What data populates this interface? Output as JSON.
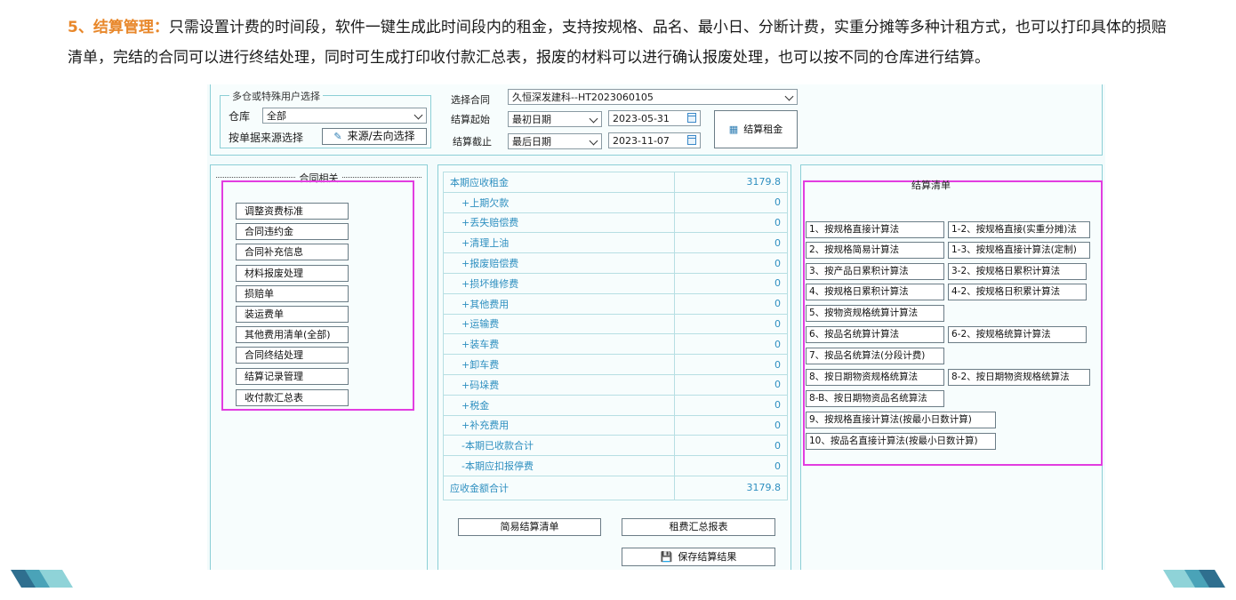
{
  "intro": {
    "highlight": "5、结算管理：",
    "text": "只需设置计费的时间段，软件一键生成此时间段内的租金，支持按规格、品名、最小日、分断计费，实重分摊等多种计租方式，也可以打印具体的损赔清单，完结的合同可以进行终结处理，同时可生成打印收付款汇总表，报废的材料可以进行确认报废处理，也可以按不同的仓库进行结算。"
  },
  "top": {
    "group_legend": "多仓或特殊用户选择",
    "warehouse_label": "仓库",
    "warehouse_value": "全部",
    "source_label": "按单据来源选择",
    "source_button": "来源/去向选择",
    "contract_label": "选择合同",
    "contract_value": "久恒深发建科--HT2023060105",
    "start_label": "结算起始",
    "start_mode": "最初日期",
    "start_date": "2023-05-31",
    "end_label": "结算截止",
    "end_mode": "最后日期",
    "end_date": "2023-11-07",
    "calc_button": "结算租金"
  },
  "left_panel": {
    "title": "合同相关",
    "buttons": [
      "调整资费标准",
      "合同违约金",
      "合同补充信息",
      "材料报废处理",
      "损赔单",
      "装运费单",
      "其他费用清单(全部)",
      "合同终结处理",
      "结算记录管理",
      "收付款汇总表"
    ]
  },
  "rent_table": {
    "header": {
      "name": "本期应收租金",
      "value": "3179.8"
    },
    "rows": [
      {
        "name": "+上期欠款",
        "value": "0"
      },
      {
        "name": "+丢失赔偿费",
        "value": "0"
      },
      {
        "name": "+清理上油",
        "value": "0"
      },
      {
        "name": "+报废赔偿费",
        "value": "0"
      },
      {
        "name": "+损坏维修费",
        "value": "0"
      },
      {
        "name": "+其他费用",
        "value": "0"
      },
      {
        "name": "+运输费",
        "value": "0"
      },
      {
        "name": "+装车费",
        "value": "0"
      },
      {
        "name": "+卸车费",
        "value": "0"
      },
      {
        "name": "+码垛费",
        "value": "0"
      },
      {
        "name": "+税金",
        "value": "0"
      },
      {
        "name": "+补充费用",
        "value": "0"
      },
      {
        "name": "-本期已收款合计",
        "value": "0"
      },
      {
        "name": "-本期应扣报停费",
        "value": "0"
      }
    ],
    "total": {
      "name": "应收金额合计",
      "value": "3179.8"
    }
  },
  "mid_buttons": {
    "simple": "简易结算清单",
    "summary": "租费汇总报表",
    "save": "保存结算结果"
  },
  "right_panel": {
    "title": "结算清单",
    "methods": [
      "1、按规格直接计算法",
      "1-2、按规格直接(实重分摊)法",
      "2、按规格简易计算法",
      "1-3、按规格直接计算法(定制)",
      "3、按产品日累积计算法",
      "3-2、按规格日累积计算法",
      "4、按规格日累积计算法",
      "4-2、按规格日积累计算法",
      "5、按物资规格统算计算法",
      "6、按品名统算计算法",
      "6-2、按规格统算计算法",
      "7、按品名统算法(分段计费)",
      "8、按日期物资规格统算法",
      "8-2、按日期物资规格统算法",
      "8-B、按日期物资品名统算法",
      "9、按规格直接计算法(按最小日数计算)",
      "10、按品名直接计算法(按最小日数计算)"
    ]
  },
  "colors": {
    "accent": "#e8872a",
    "panel_border": "#8ccfd6",
    "table_text": "#2e8fc0",
    "highlight_box": "#e23de0"
  }
}
